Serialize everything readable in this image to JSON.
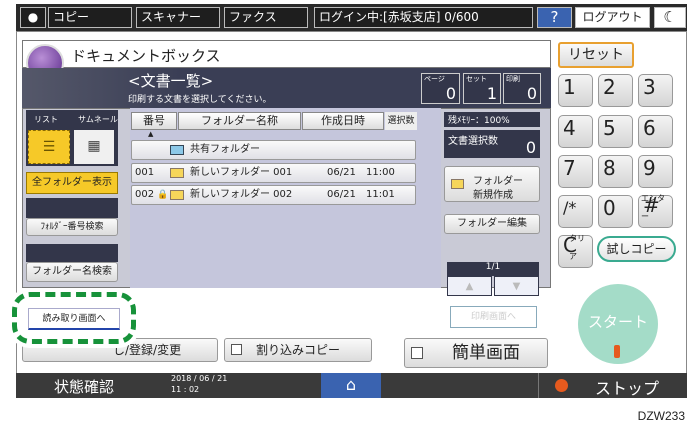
{
  "topbar": {
    "tabs": [
      "コピー",
      "スキャナー",
      "ファクス"
    ],
    "login": "ログイン中:[赤坂支店] 0/600",
    "help": "?",
    "logout": "ログアウト",
    "moon": "☾"
  },
  "app": {
    "title": "ドキュメントボックス",
    "heading": "<文書一覧>",
    "instruction": "印刷する文書を選択してください。"
  },
  "counters": [
    {
      "label": "ページ",
      "value": "0"
    },
    {
      "label": "セット",
      "value": "1"
    },
    {
      "label": "印刷",
      "value": "0"
    }
  ],
  "left": {
    "list_label": "リスト",
    "thumb_label": "サムネール",
    "all_folders": "全フォルダー表示",
    "number_search": "ﾌｫﾙﾀﾞｰ番号検索",
    "name_search": "フォルダー名検索",
    "scan_screen": "読み取り画面へ"
  },
  "table": {
    "columns": [
      "番号",
      "フォルダー名称",
      "作成日時",
      "選択数"
    ],
    "shared": "共有フォルダー",
    "rows": [
      {
        "no": "001",
        "name": "新しいフォルダー 001",
        "date": "06/21",
        "time": "11:00",
        "locked": false
      },
      {
        "no": "002",
        "name": "新しいフォルダー 002",
        "date": "06/21",
        "time": "11:01",
        "locked": true
      }
    ]
  },
  "right": {
    "memory": "残ﾒﾓﾘｰ：100%",
    "selected_label": "文書選択数",
    "selected_count": "0",
    "new_folder": [
      "フォルダー",
      "新規作成"
    ],
    "edit_folder": "フォルダー編集",
    "page": "1/1",
    "print_screen": "印刷画面へ"
  },
  "keypad": {
    "reset": "リセット",
    "keys": [
      "1",
      "2",
      "3",
      "4",
      "5",
      "6",
      "7",
      "8",
      "9",
      "/*",
      "0",
      "#"
    ],
    "hash_sub": "エンター",
    "clear": "C",
    "clear_sub": "クリア",
    "trial": "試しコピー",
    "start": "スタート"
  },
  "bottom": {
    "recall": "し/登録/変更",
    "interrupt": "割り込みコピー",
    "simple": "簡単画面"
  },
  "status": {
    "label": "状態確認",
    "date": "2018 / 06 / 21",
    "time": "11 : 02",
    "stop": "ストップ"
  },
  "figure_id": "DZW233",
  "colors": {
    "accent_yellow": "#f6c928",
    "highlight_green": "#17923a",
    "home_blue": "#3a63b0",
    "start_green": "#a4dcc8"
  }
}
